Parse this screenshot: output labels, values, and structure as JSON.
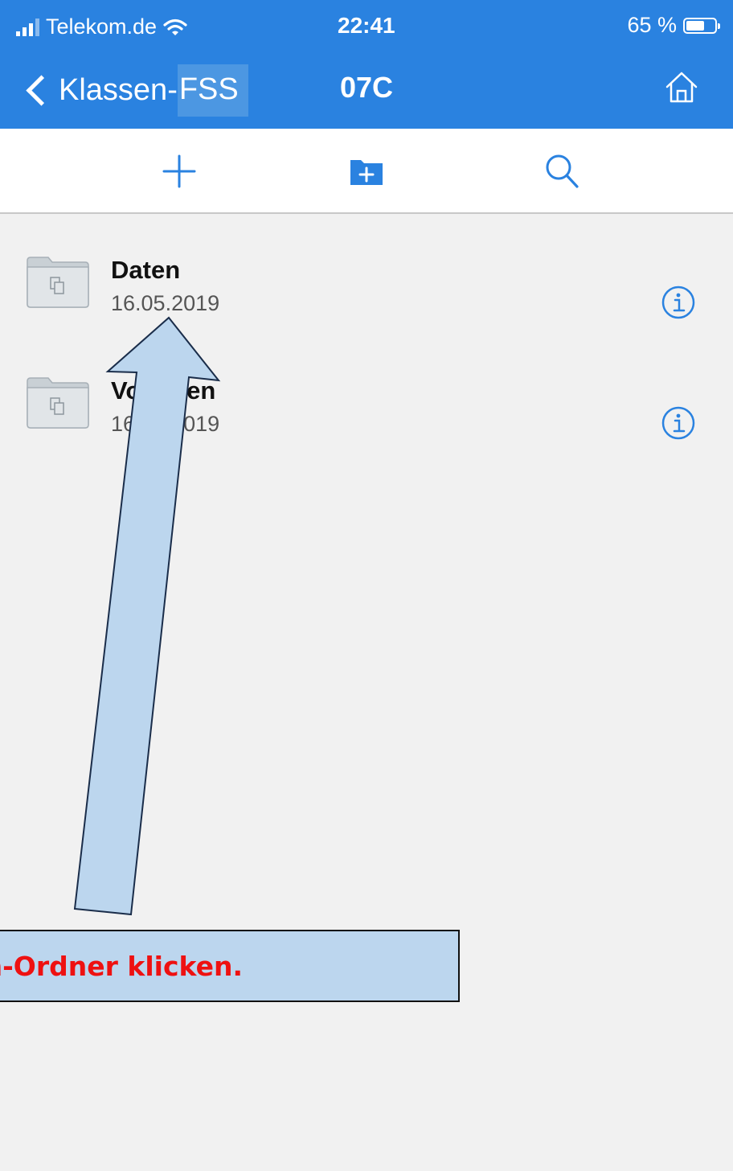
{
  "status_bar": {
    "carrier": "Telekom.de",
    "time": "22:41",
    "battery": "65 %",
    "battery_level": 0.65
  },
  "nav": {
    "back_label_prefix": "Klassen-",
    "back_label_highlight": "FSS",
    "title": "07C",
    "home_icon": "home-icon"
  },
  "toolbar": {
    "add_icon": "plus-icon",
    "new_folder_icon": "new-folder-icon",
    "search_icon": "search-icon"
  },
  "files": [
    {
      "name": "Daten",
      "date": "16.05.2019"
    },
    {
      "name": "Vorlagen",
      "date": "16.05.2019"
    }
  ],
  "annotation": {
    "text": "n-Ordner klicken."
  },
  "colors": {
    "accent": "#2a82e0",
    "annotation_fill": "#bcd6ee",
    "annotation_text": "#ee1111"
  }
}
